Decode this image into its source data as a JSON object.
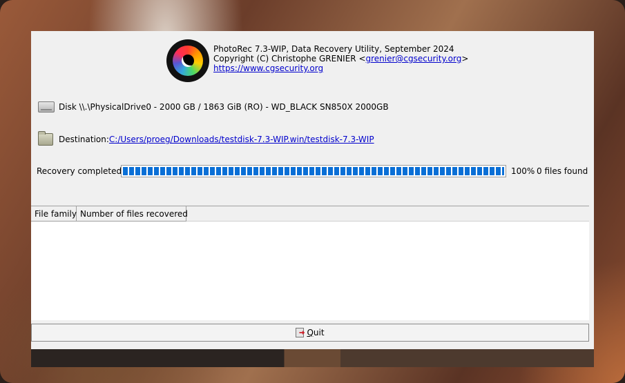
{
  "header": {
    "line1": "PhotoRec 7.3-WIP, Data Recovery Utility, September 2024",
    "copyright_prefix": "Copyright (C) Christophe GRENIER <",
    "email": "grenier@cgsecurity.org",
    "copyright_suffix": ">",
    "website": "https://www.cgsecurity.org"
  },
  "disk": {
    "icon": "hard-disk-icon",
    "label": "Disk \\\\.\\PhysicalDrive0 - 2000 GB / 1863 GiB (RO) - WD_BLACK SN850X 2000GB"
  },
  "destination": {
    "icon": "folder-icon",
    "label": "Destination: ",
    "path": "C:/Users/proeg/Downloads/testdisk-7.3-WIP.win/testdisk-7.3-WIP"
  },
  "progress": {
    "label": "Recovery completed",
    "percent": "100%",
    "fraction": 1.0,
    "files_found": "0 files found",
    "color": "#0a6fd6"
  },
  "results_table": {
    "columns": [
      "File family",
      "Number of files recovered"
    ],
    "rows": []
  },
  "quit_button": {
    "icon": "exit-icon",
    "label": "Quit"
  }
}
